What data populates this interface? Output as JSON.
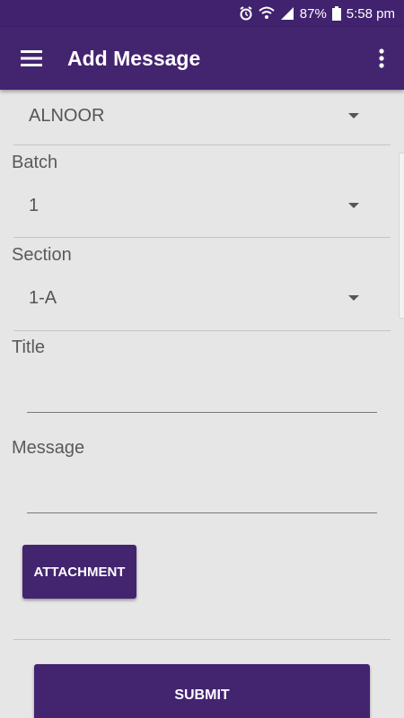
{
  "status": {
    "battery": "87%",
    "time": "5:58 pm"
  },
  "appbar": {
    "title": "Add Message",
    "menu_icon": "hamburger-menu-icon",
    "more_icon": "more-vert-icon"
  },
  "form": {
    "school_value": "ALNOOR",
    "batch_label": "Batch",
    "batch_value": "1",
    "section_label": "Section",
    "section_value": "1-A",
    "title_label": "Title",
    "title_value": "",
    "message_label": "Message",
    "message_value": "",
    "attachment_label": "ATTACHMENT",
    "submit_label": "SUBMIT"
  },
  "colors": {
    "primary": "#43246f",
    "background": "#e6e6e6"
  }
}
